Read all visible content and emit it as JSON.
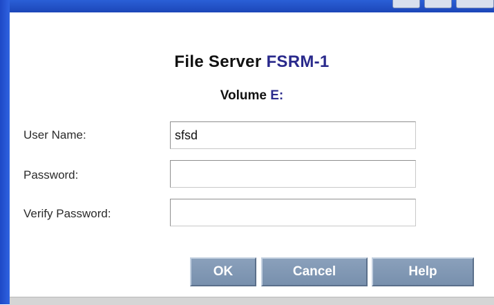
{
  "dialog": {
    "server_label": "File Server",
    "server_name": "FSRM-1",
    "volume_label": "Volume",
    "volume_name": "E:"
  },
  "form": {
    "user_name_label": "User Name:",
    "user_name_value": "sfsd",
    "password_label": "Password:",
    "password_value": "",
    "verify_password_label": "Verify Password:",
    "verify_password_value": ""
  },
  "buttons": {
    "ok": "OK",
    "cancel": "Cancel",
    "help": "Help"
  },
  "colors": {
    "title_accent": "#2a2a8c",
    "button_bg": "#7f96b3",
    "window_border": "#2455d3"
  }
}
